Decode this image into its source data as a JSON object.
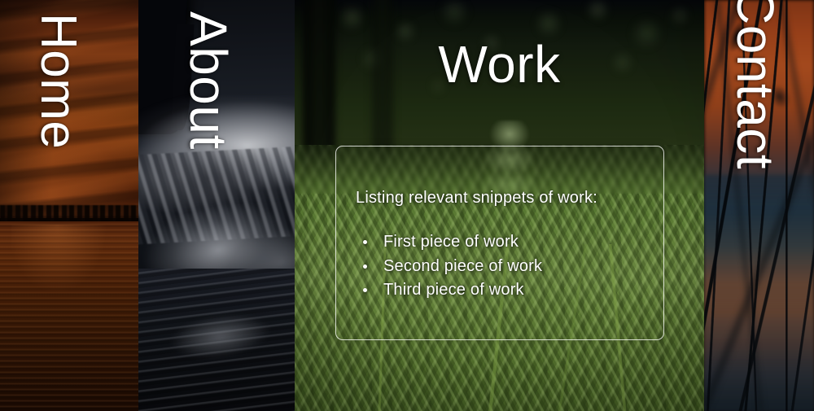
{
  "nav": {
    "panels": [
      {
        "id": "home",
        "label": "Home",
        "scene": "sunset-over-water"
      },
      {
        "id": "about",
        "label": "About",
        "scene": "monochrome-ocean-wave"
      },
      {
        "id": "contact",
        "label": "Contact",
        "scene": "reeds-at-dusk"
      }
    ]
  },
  "work": {
    "title": "Work",
    "scene": "green-ferns-forest",
    "card": {
      "lead": "Listing relevant snippets of work:",
      "items": [
        "First piece of work",
        "Second piece of work",
        "Third piece of work"
      ]
    }
  },
  "colors": {
    "text": "#ffffff",
    "card_border": "rgba(255,255,255,0.78)",
    "home_accent": "#803e12",
    "about_accent": "#1b1f27",
    "work_accent": "#6a8740",
    "contact_accent": "#a3491d"
  }
}
